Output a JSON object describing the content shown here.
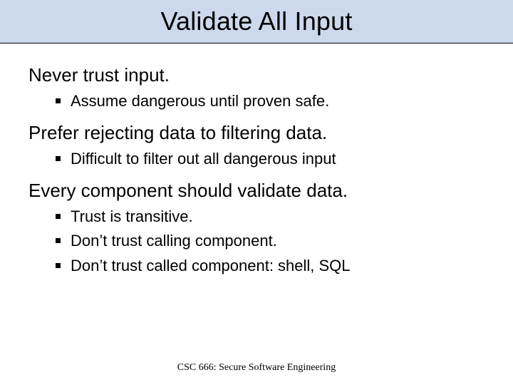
{
  "title": "Validate All Input",
  "sections": [
    {
      "heading": "Never trust input.",
      "bullets": [
        "Assume dangerous until proven safe."
      ]
    },
    {
      "heading": "Prefer rejecting data to filtering data.",
      "bullets": [
        "Difficult to filter out all dangerous input"
      ]
    },
    {
      "heading": "Every component should validate data.",
      "bullets": [
        "Trust is transitive.",
        "Don’t trust calling component.",
        "Don’t trust called component: shell, SQL"
      ]
    }
  ],
  "footer": "CSC 666: Secure Software Engineering"
}
